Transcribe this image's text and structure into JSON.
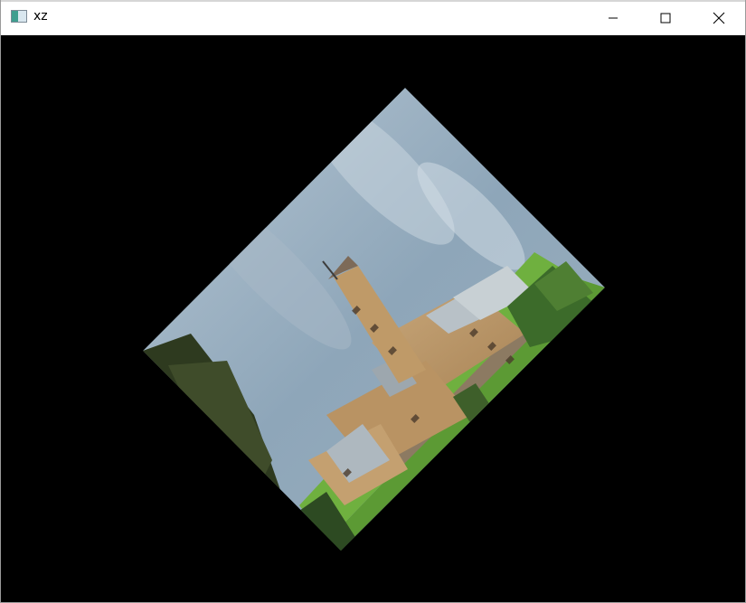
{
  "window": {
    "title": "xz",
    "app_icon": "image-window-icon",
    "controls": {
      "minimize": "minimize-icon",
      "maximize": "maximize-icon",
      "close": "close-icon"
    }
  },
  "canvas": {
    "background": "#000000",
    "image": {
      "subject": "photo",
      "rotation_degrees": 45
    }
  }
}
